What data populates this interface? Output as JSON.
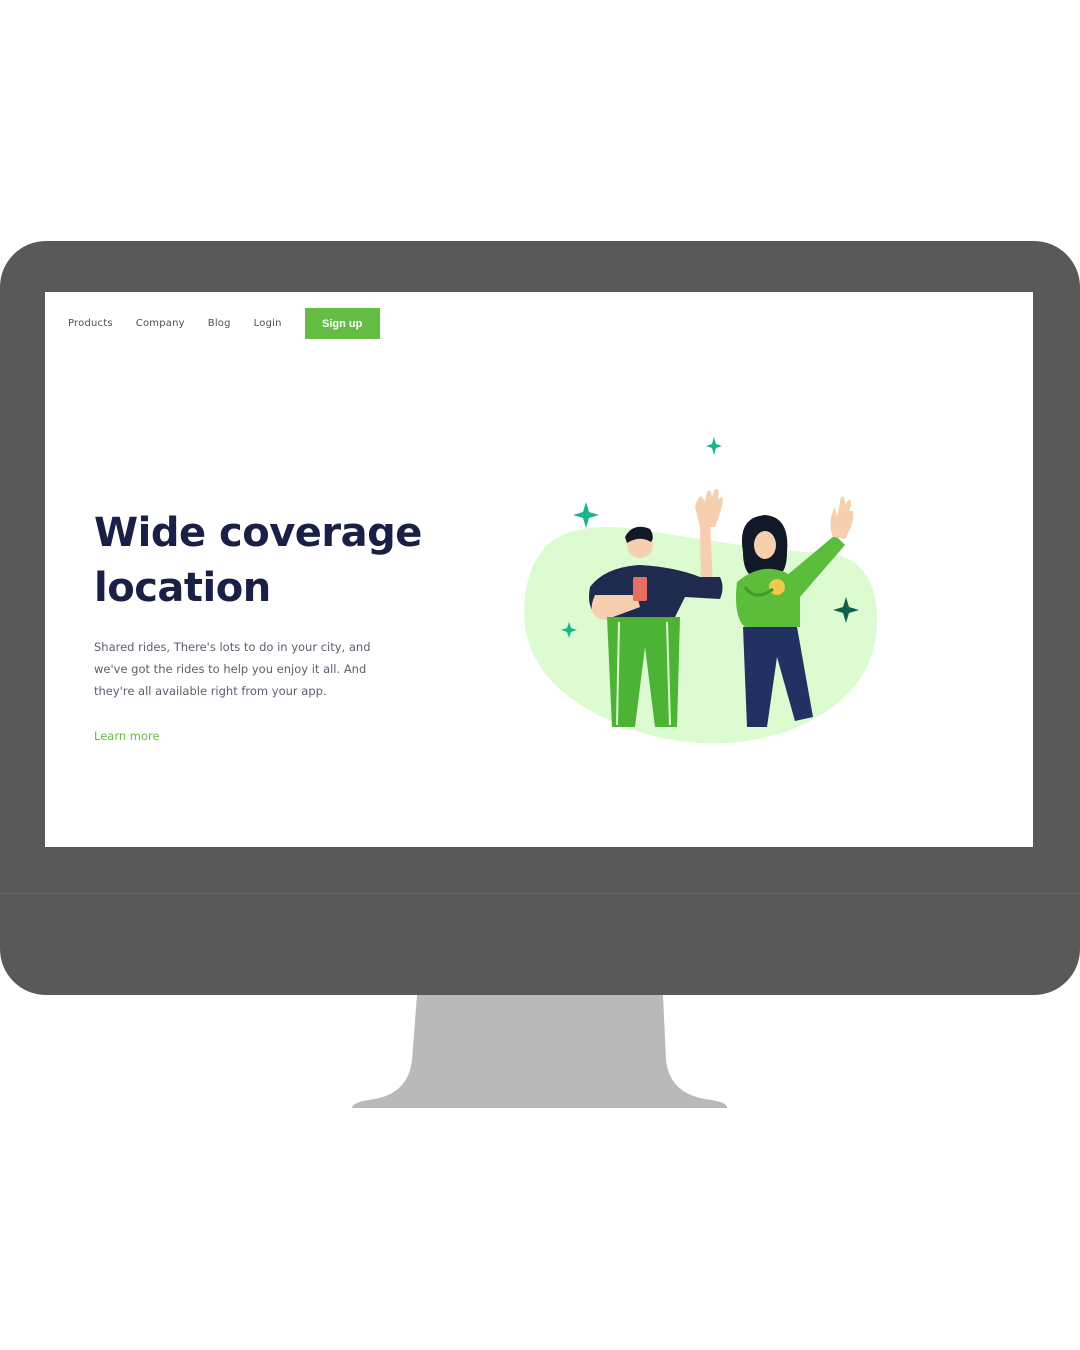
{
  "nav": {
    "items": [
      "Products",
      "Company",
      "Blog",
      "Login"
    ],
    "signup_label": "Sign up"
  },
  "hero": {
    "title_line1": "Wide coverage",
    "title_line2": "location",
    "description": "Shared rides, There's lots to do in your city, and we've got the rides to help you enjoy it all. And they're all available right from your app.",
    "learn_more": "Learn more"
  },
  "colors": {
    "accent": "#65bd45",
    "heading": "#1a1f45",
    "monitor": "#595959",
    "stand": "#b9b9b9"
  }
}
